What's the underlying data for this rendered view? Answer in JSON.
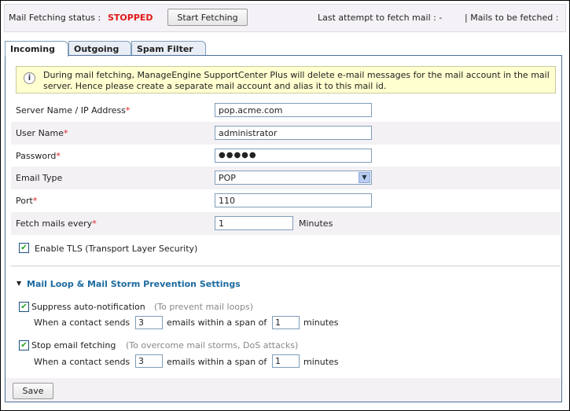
{
  "topbar": {
    "status_label": "Mail Fetching status :",
    "status_value": "STOPPED",
    "start_button": "Start Fetching",
    "last_attempt": "Last attempt to fetch mail : -",
    "mails_to_fetch": "| Mails to be fetched :"
  },
  "tabs": [
    {
      "label": "Incoming",
      "active": true
    },
    {
      "label": "Outgoing"
    },
    {
      "label": "Spam Filter"
    }
  ],
  "info": {
    "icon": "info-icon",
    "text": "During mail fetching, ManageEngine SupportCenter Plus will delete e-mail messages for the mail account in the mail server. Hence please create a separate mail account and alias it to this mail id."
  },
  "form": {
    "server": {
      "label": "Server Name / IP Address",
      "value": "pop.acme.com"
    },
    "user": {
      "label": "User Name",
      "value": "administrator"
    },
    "password": {
      "label": "Password",
      "value": "●●●●●"
    },
    "email_type": {
      "label": "Email Type",
      "value": "POP"
    },
    "port": {
      "label": "Port",
      "value": "110"
    },
    "fetch": {
      "label": "Fetch mails every",
      "value": "1",
      "unit": "Minutes"
    },
    "tls": {
      "label": "Enable TLS (Transport Layer Security)",
      "checked": true
    }
  },
  "required_mark": "*",
  "loop": {
    "title": "Mail Loop & Mail Storm Prevention Settings",
    "suppress": {
      "label": "Suppress auto-notification",
      "hint": "(To prevent mail loops)",
      "checked": true,
      "pre": "When a contact sends",
      "count": "3",
      "mid": "emails within a span of",
      "minutes": "1",
      "post": "minutes"
    },
    "stop": {
      "label": "Stop email fetching",
      "hint": "(To overcome mail storms, DoS attacks)",
      "checked": true,
      "pre": "When a contact sends",
      "count": "3",
      "mid": "emails within a span of",
      "minutes": "1",
      "post": "minutes"
    }
  },
  "save_button": "Save"
}
